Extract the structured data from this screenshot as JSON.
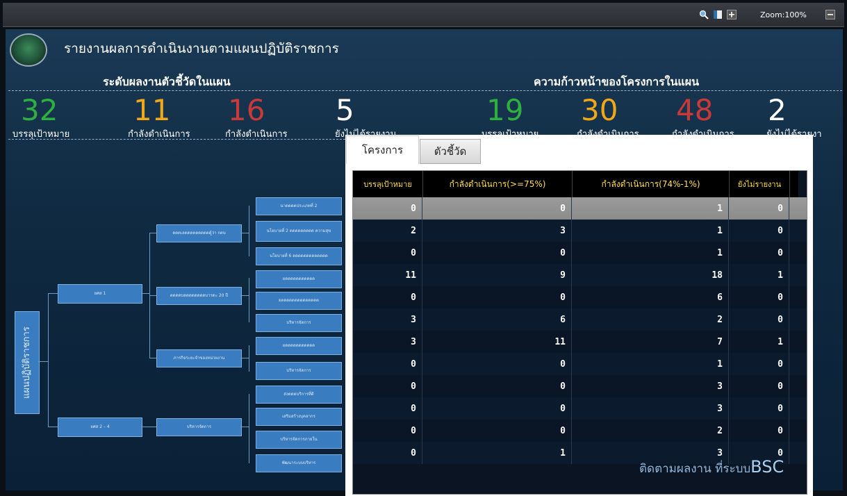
{
  "toolbar": {
    "zoom_label": "Zoom:100%"
  },
  "header": {
    "title": "รายงานผลการดำเนินงานตามแผนปฏิบัติราชการ"
  },
  "left_section": {
    "title": "ระดับผลงานตัวชี้วัดในแผน",
    "stats": [
      {
        "value": "32",
        "label": "บรรลุเป้าหมาย"
      },
      {
        "value": "11",
        "label": "กำลังดำเนินการ"
      },
      {
        "value": "16",
        "label": "กำลังดำเนินการ"
      },
      {
        "value": "5",
        "label": "ยังไม่ได้รายงาน"
      }
    ]
  },
  "right_section": {
    "title": "ความก้าวหน้าของโครงการในแผน",
    "stats": [
      {
        "value": "19",
        "label": "บรรลุเป้าหมาย"
      },
      {
        "value": "30",
        "label": "กำลังดำเนินการ"
      },
      {
        "value": "48",
        "label": "กำลังดำเนินการ"
      },
      {
        "value": "2",
        "label": "ยังไม่ได้รายงา"
      }
    ]
  },
  "tree": {
    "root": "แผนปฏิบัติราชการ",
    "level1": [
      "ยศส 1",
      "ยศส 2 – 4"
    ],
    "level2": [
      "ดดดเลดดดดดดดดดดู้ว่า กดบ",
      "ดดดดบดดดดดดดดบารดะ 20 ปี",
      "ภารกิจระยะจำของหน่วยงาน",
      "บริหารจัดการ"
    ],
    "level3": [
      "นาดดดดประเภทที่ 2",
      "นโยบายที่ 2 ดดดดดดดดด ความสุข",
      "นโยบายที่ 6 ดดดดดดดดดดดดด",
      "ยดดดดดดดดดดด",
      "ยดดดดดดดดดดดดดด",
      "บริหารจัดการ",
      "ยดดดดดดดดดดด",
      "บริหารจัดการ",
      "ส่งดดดบริการที่ดี",
      "เสริมสร้างบุคลากร",
      "บริหารจัดการภายใน",
      "พัฒนาระบบบริหาร"
    ]
  },
  "panel": {
    "tabs": [
      "โครงการ",
      "ตัวชี้วัด"
    ],
    "columns": [
      "บรรลุเป้าหมาย",
      "กำลังดำเนินการ(>=75%)",
      "กำลังดำเนินการ(74%-1%)",
      "ยังไม่รายงาน"
    ],
    "rows": [
      [
        "0",
        "0",
        "1",
        "0"
      ],
      [
        "2",
        "3",
        "1",
        "0"
      ],
      [
        "0",
        "0",
        "1",
        "0"
      ],
      [
        "11",
        "9",
        "18",
        "1"
      ],
      [
        "0",
        "0",
        "6",
        "0"
      ],
      [
        "3",
        "6",
        "2",
        "0"
      ],
      [
        "3",
        "11",
        "7",
        "1"
      ],
      [
        "0",
        "0",
        "1",
        "0"
      ],
      [
        "0",
        "0",
        "3",
        "0"
      ],
      [
        "0",
        "0",
        "3",
        "0"
      ],
      [
        "0",
        "0",
        "2",
        "0"
      ],
      [
        "0",
        "1",
        "3",
        "0"
      ]
    ]
  },
  "watermark": {
    "text": "ติดตามผลงาน ที่ระบบ",
    "brand": "BSC"
  },
  "colors": {
    "green": "#2faf3f",
    "orange": "#f0a818",
    "red": "#c83a3a",
    "header_text": "#ffe04a"
  }
}
